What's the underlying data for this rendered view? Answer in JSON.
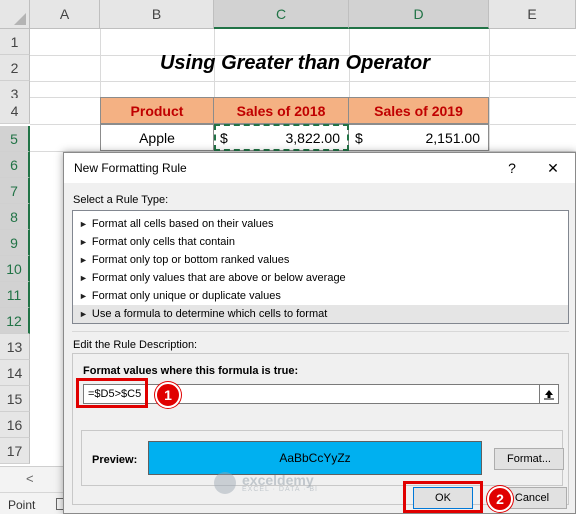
{
  "columns": [
    "A",
    "B",
    "C",
    "D",
    "E"
  ],
  "rows": [
    "1",
    "2",
    "3",
    "4",
    "5",
    "6",
    "7",
    "8",
    "9",
    "10",
    "11",
    "12",
    "13",
    "14",
    "15",
    "16",
    "17"
  ],
  "sheet": {
    "title": "Using Greater than Operator",
    "headers": [
      "Product",
      "Sales of 2018",
      "Sales of 2019"
    ],
    "row5": {
      "product": "Apple",
      "cur1": "$",
      "val1": "3,822.00",
      "cur2": "$",
      "val2": "2,151.00"
    }
  },
  "status": {
    "mode": "Point"
  },
  "dialog": {
    "title": "New Formatting Rule",
    "help": "?",
    "close": "✕",
    "select_rule_type_label": "Select a Rule Type:",
    "rule_types": [
      "Format all cells based on their values",
      "Format only cells that contain",
      "Format only top or bottom ranked values",
      "Format only values that are above or below average",
      "Format only unique or duplicate values",
      "Use a formula to determine which cells to format"
    ],
    "edit_description_label": "Edit the Rule Description:",
    "formula_label": "Format values where this formula is true:",
    "formula_value": "=$D5>$C5",
    "preview_label": "Preview:",
    "preview_sample": "AaBbCcYyZz",
    "preview_color": "#00b0f0",
    "format_button": "Format...",
    "ok_button": "OK",
    "cancel_button": "Cancel"
  },
  "annotations": {
    "badge1": "1",
    "badge2": "2"
  },
  "watermark": {
    "name": "exceldemy",
    "tagline": "EXCEL · DATA · BI"
  }
}
